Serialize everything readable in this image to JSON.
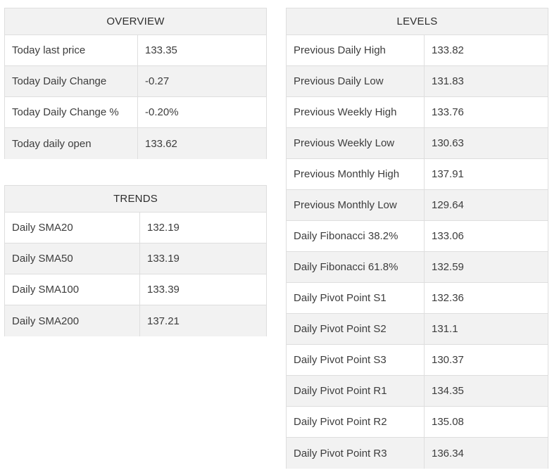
{
  "overview": {
    "title": "OVERVIEW",
    "rows": [
      {
        "label": "Today last price",
        "value": "133.35"
      },
      {
        "label": "Today Daily Change",
        "value": "-0.27"
      },
      {
        "label": "Today Daily Change %",
        "value": "-0.20%"
      },
      {
        "label": "Today daily open",
        "value": "133.62"
      }
    ]
  },
  "trends": {
    "title": "TRENDS",
    "rows": [
      {
        "label": "Daily SMA20",
        "value": "132.19"
      },
      {
        "label": "Daily SMA50",
        "value": "133.19"
      },
      {
        "label": "Daily SMA100",
        "value": "133.39"
      },
      {
        "label": "Daily SMA200",
        "value": "137.21"
      }
    ]
  },
  "levels": {
    "title": "LEVELS",
    "rows": [
      {
        "label": "Previous Daily High",
        "value": "133.82"
      },
      {
        "label": "Previous Daily Low",
        "value": "131.83"
      },
      {
        "label": "Previous Weekly High",
        "value": "133.76"
      },
      {
        "label": "Previous Weekly Low",
        "value": "130.63"
      },
      {
        "label": "Previous Monthly High",
        "value": "137.91"
      },
      {
        "label": "Previous Monthly Low",
        "value": "129.64"
      },
      {
        "label": "Daily Fibonacci 38.2%",
        "value": "133.06"
      },
      {
        "label": "Daily Fibonacci 61.8%",
        "value": "132.59"
      },
      {
        "label": "Daily Pivot Point S1",
        "value": "132.36"
      },
      {
        "label": "Daily Pivot Point S2",
        "value": "131.1"
      },
      {
        "label": "Daily Pivot Point S3",
        "value": "130.37"
      },
      {
        "label": "Daily Pivot Point R1",
        "value": "134.35"
      },
      {
        "label": "Daily Pivot Point R2",
        "value": "135.08"
      },
      {
        "label": "Daily Pivot Point R3",
        "value": "136.34"
      }
    ]
  }
}
